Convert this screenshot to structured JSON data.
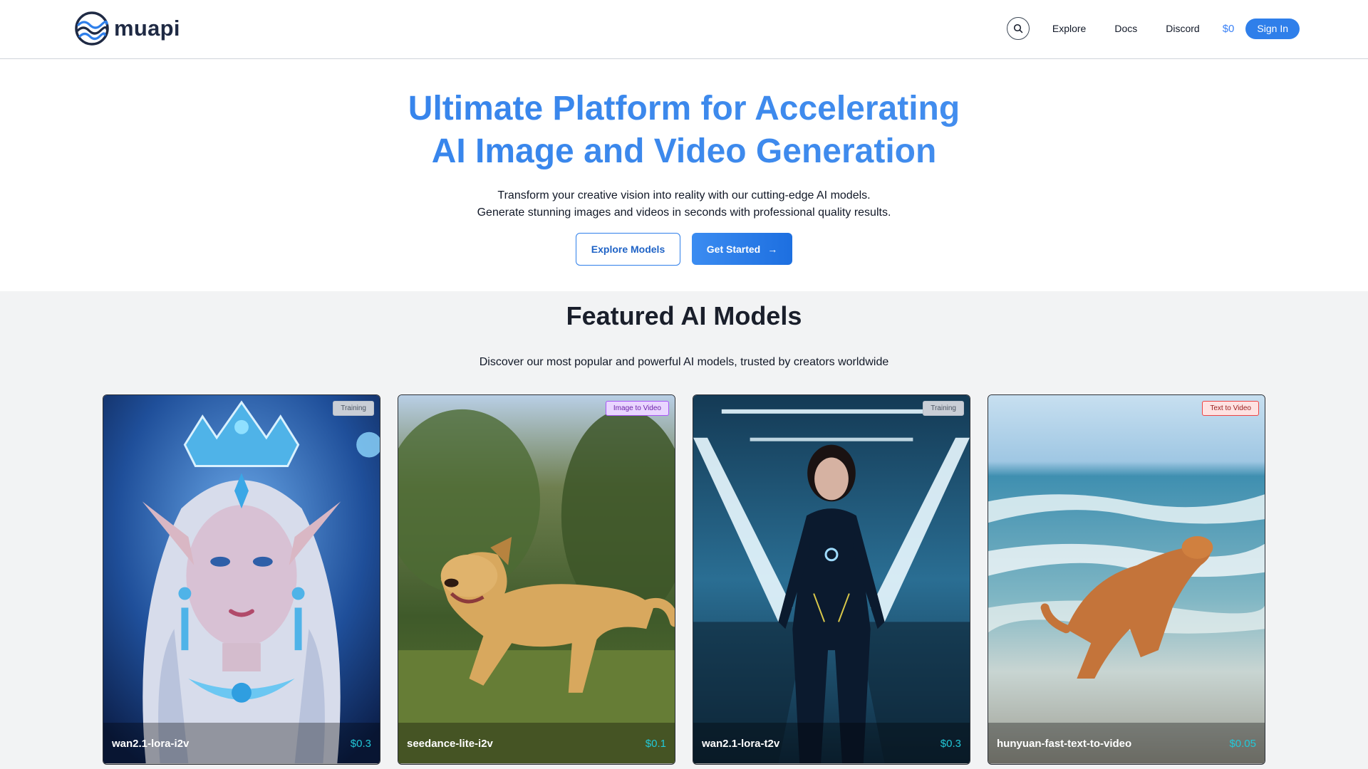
{
  "header": {
    "brand": "muapi",
    "nav": [
      "Explore",
      "Docs",
      "Discord"
    ],
    "credit": "$0",
    "signin": "Sign In"
  },
  "hero": {
    "title_line1": "Ultimate Platform for Accelerating",
    "title_line2": "AI Image and Video Generation",
    "sub_line1": "Transform your creative vision into reality with our cutting-edge AI models.",
    "sub_line2": "Generate stunning images and videos in seconds with professional quality results.",
    "explore_btn": "Explore Models",
    "start_btn": "Get Started",
    "start_arrow": "→"
  },
  "featured": {
    "title": "Featured AI Models",
    "subtitle": "Discover our most popular and powerful AI models, trusted by creators worldwide",
    "cards": [
      {
        "name": "wan2.1-lora-i2v",
        "price": "$0.3",
        "badge": "Training",
        "badge_type": "training",
        "image": "elf-queen-portrait"
      },
      {
        "name": "seedance-lite-i2v",
        "price": "$0.1",
        "badge": "Image to Video",
        "badge_type": "i2v",
        "image": "golden-retriever-running"
      },
      {
        "name": "wan2.1-lora-t2v",
        "price": "$0.3",
        "badge": "Training",
        "badge_type": "training",
        "image": "woman-in-sci-fi-corridor"
      },
      {
        "name": "hunyuan-fast-text-to-video",
        "price": "$0.05",
        "badge": "Text to Video",
        "badge_type": "t2v",
        "image": "dog-running-on-beach"
      }
    ]
  },
  "colors": {
    "accent": "#2f7fea",
    "price": "#22c8d8",
    "section_bg": "#f2f3f4"
  }
}
